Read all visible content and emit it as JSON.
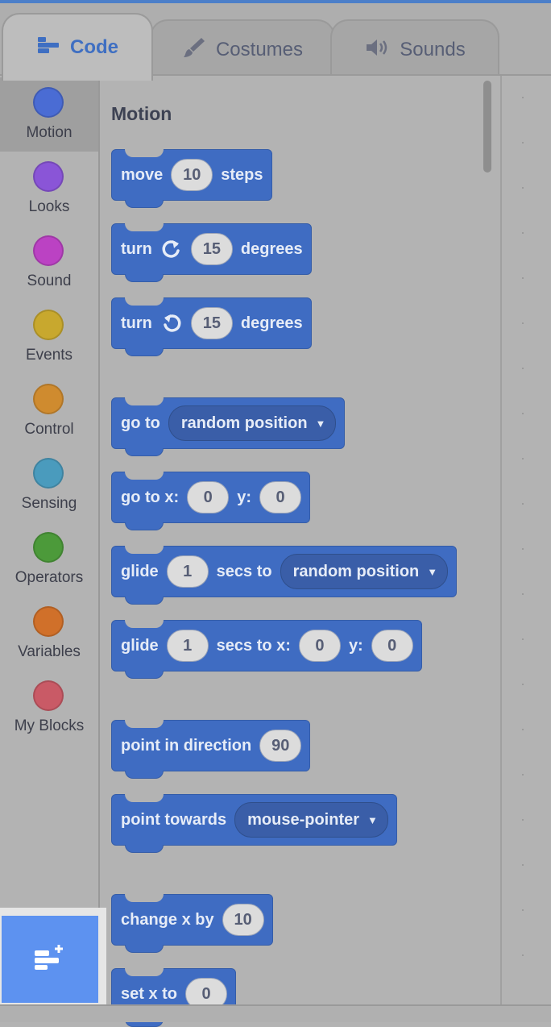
{
  "tabs": [
    {
      "label": "Code",
      "icon": "code-icon",
      "active": true
    },
    {
      "label": "Costumes",
      "icon": "brush-icon",
      "active": false
    },
    {
      "label": "Sounds",
      "icon": "speaker-icon",
      "active": false
    }
  ],
  "categories": [
    {
      "label": "Motion",
      "color": "#4a6cd4",
      "selected": true
    },
    {
      "label": "Looks",
      "color": "#8a55d7"
    },
    {
      "label": "Sound",
      "color": "#bb42c3"
    },
    {
      "label": "Events",
      "color": "#c8a82e"
    },
    {
      "label": "Control",
      "color": "#cf8b2f"
    },
    {
      "label": "Sensing",
      "color": "#4a9bbd"
    },
    {
      "label": "Operators",
      "color": "#4c9a3a"
    },
    {
      "label": "Variables",
      "color": "#d0702a"
    },
    {
      "label": "My Blocks",
      "color": "#c95a66"
    }
  ],
  "flyout": {
    "section_title": "Motion",
    "blocks": {
      "move": {
        "t1": "move",
        "v1": "10",
        "t2": "steps"
      },
      "turn_right": {
        "t1": "turn",
        "v1": "15",
        "t2": "degrees"
      },
      "turn_left": {
        "t1": "turn",
        "v1": "15",
        "t2": "degrees"
      },
      "goto": {
        "t1": "go to",
        "d1": "random position"
      },
      "gotoxy": {
        "t1": "go to x:",
        "v1": "0",
        "t2": "y:",
        "v2": "0"
      },
      "glide_to": {
        "t1": "glide",
        "v1": "1",
        "t2": "secs to",
        "d1": "random position"
      },
      "glide_xy": {
        "t1": "glide",
        "v1": "1",
        "t2": "secs to x:",
        "v2": "0",
        "t3": "y:",
        "v3": "0"
      },
      "point_dir": {
        "t1": "point in direction",
        "v1": "90"
      },
      "point_towards": {
        "t1": "point towards",
        "d1": "mouse-pointer"
      },
      "change_x": {
        "t1": "change x by",
        "v1": "10"
      },
      "set_x": {
        "t1": "set x to",
        "v1": "0"
      }
    }
  },
  "extension_button": {
    "icon": "add-extension-icon"
  },
  "colors": {
    "accent": "#3f6cc2",
    "motion_block": "#3f6cc2",
    "extension_button": "#5d92f0"
  }
}
